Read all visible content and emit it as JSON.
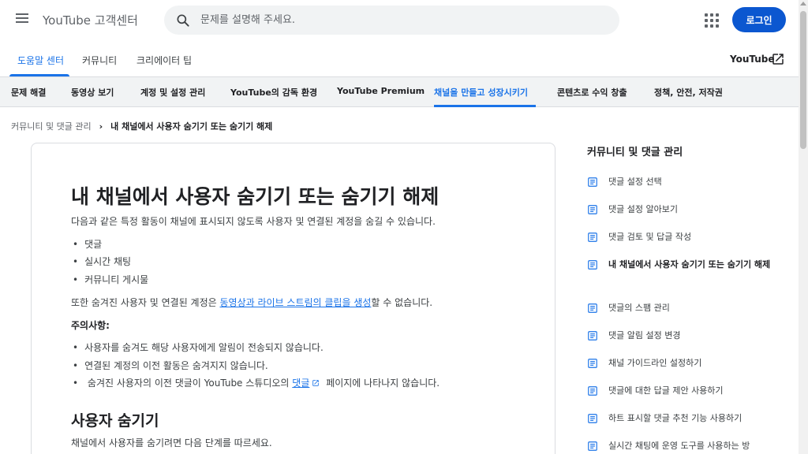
{
  "header": {
    "brand": "YouTube 고객센터",
    "search_placeholder": "문제를 설명해 주세요.",
    "login_label": "로그인"
  },
  "subnav": {
    "items": [
      "도움말 센터",
      "커뮤니티",
      "크리에이터 팁"
    ],
    "active_index": 0,
    "youtube_link": "YouTube"
  },
  "categories": {
    "items": [
      "문제 해결",
      "동영상 보기",
      "계정 및 설정 관리",
      "YouTube의 감독 환경",
      "YouTube Premium",
      "채널을 만들고 성장시키기",
      "콘텐츠로 수익 창출",
      "정책, 안전, 저작권"
    ],
    "active_index": 5
  },
  "breadcrumb": {
    "parent": "커뮤니티 및 댓글 관리",
    "current": "내 채널에서 사용자 숨기기 또는 숨기기 해제"
  },
  "article": {
    "title": "내 채널에서 사용자 숨기기 또는 숨기기 해제",
    "intro": "다음과 같은 특정 활동이 채널에 표시되지 않도록 사용자 및 연결된 계정을 숨길 수 있습니다.",
    "activities": [
      "댓글",
      "실시간 채팅",
      "커뮤니티 게시물"
    ],
    "clip_before": "또한 숨겨진 사용자 및 연결된 계정은 ",
    "clip_link": "동영상과 라이브 스트림의 클립을 생성",
    "clip_after": "할 수 없습니다.",
    "notes_heading": "주의사항:",
    "note1": "사용자를 숨겨도 해당 사용자에게 알림이 전송되지 않습니다.",
    "note2": "연결된 계정의 이전 활동은 숨겨지지 않습니다.",
    "note3_before": "숨겨진 사용자의 이전 댓글이 YouTube 스튜디오의 ",
    "note3_link": "댓글",
    "note3_after": " 페이지에 나타나지 않습니다.",
    "section_title": "사용자 숨기기",
    "section_intro": "채널에서 사용자를 숨기려면 다음 단계를 따르세요."
  },
  "sidebar": {
    "title": "커뮤니티 및 댓글 관리",
    "items": [
      "댓글 설정 선택",
      "댓글 설정 알아보기",
      "댓글 검토 및 답글 작성",
      "내 채널에서 사용자 숨기기 또는 숨기기 해제",
      "댓글의 스팸 관리",
      "댓글 알림 설정 변경",
      "채널 가이드라인 설정하기",
      "댓글에 대한 답글 제안 사용하기",
      "하트 표시할 댓글 추천 기능 사용하기",
      "실시간 채팅에 운영 도구를 사용하는 방"
    ],
    "active_index": 3
  },
  "colors": {
    "accent": "#1a73e8",
    "login_bg": "#0b57d0",
    "tab_bar_bg": "#f1f3f4"
  }
}
